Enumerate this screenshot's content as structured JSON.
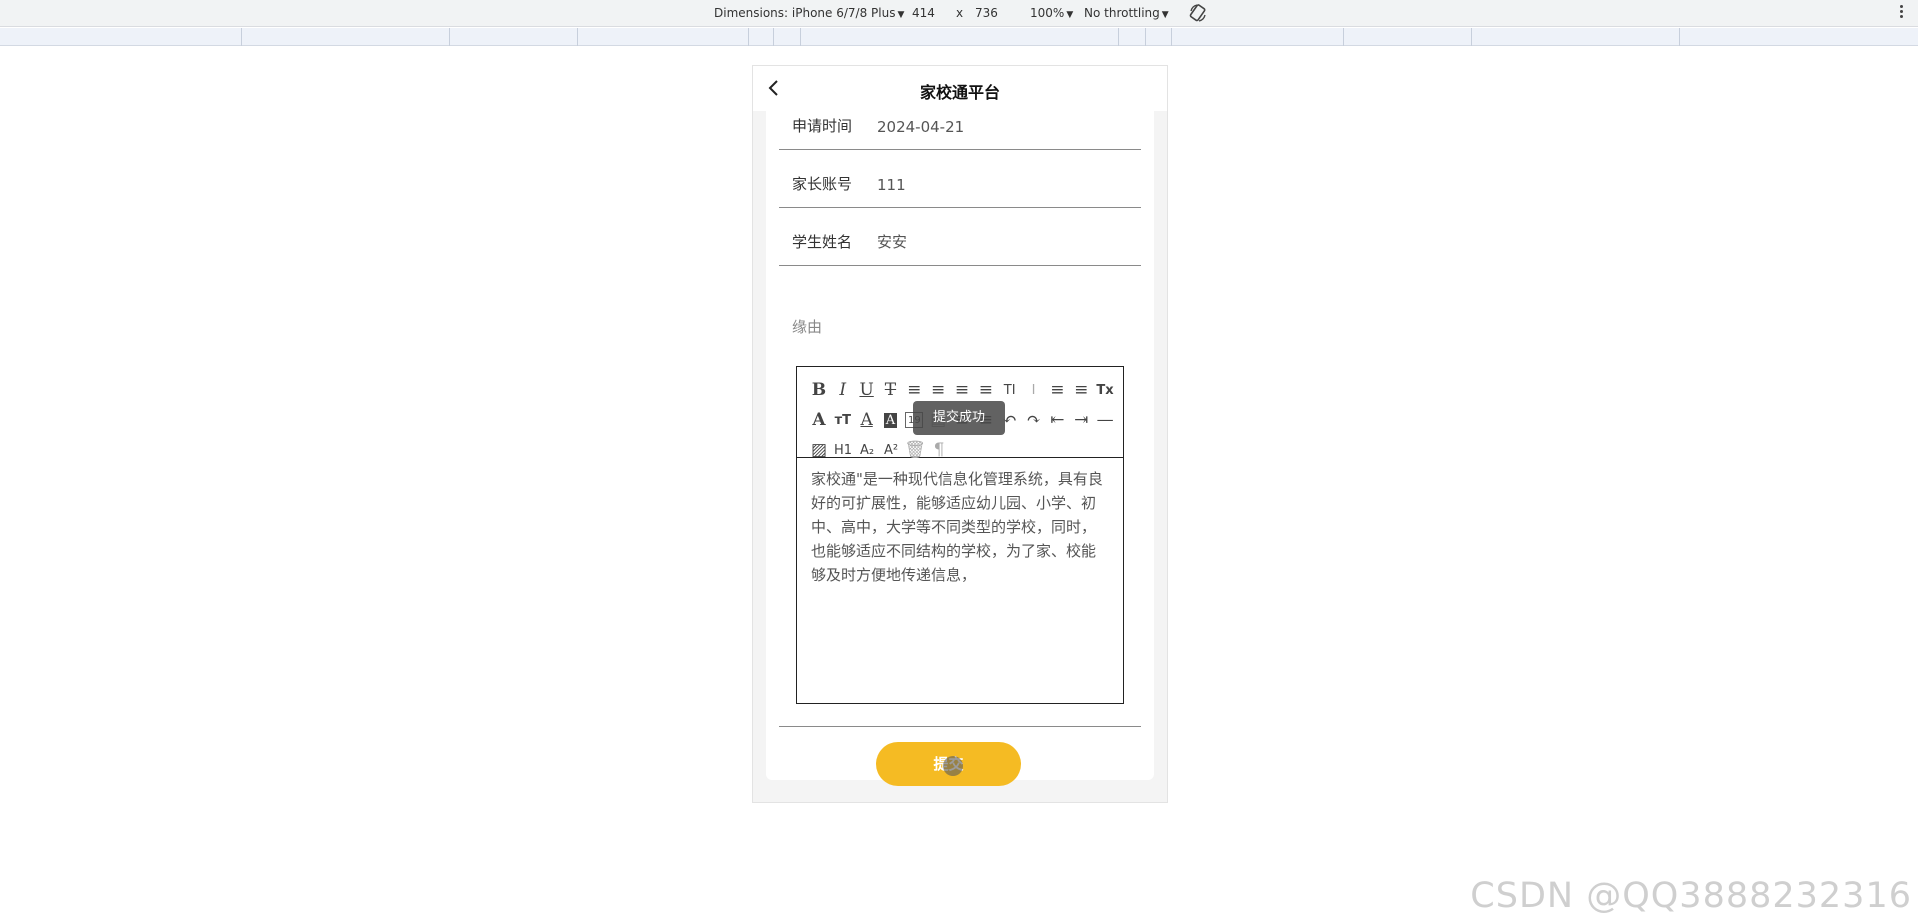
{
  "devtools": {
    "dimensions_label": "Dimensions: iPhone 6/7/8 Plus",
    "width": "414",
    "times": "x",
    "height": "736",
    "zoom": "100%",
    "throttling": "No throttling"
  },
  "header": {
    "title": "家校通平台"
  },
  "form": {
    "fields": [
      {
        "label": "申请时间",
        "value": "2024-04-21"
      },
      {
        "label": "家长账号",
        "value": "111"
      },
      {
        "label": "学生姓名",
        "value": "安安"
      }
    ],
    "reason_label": "缘由",
    "editor_content": "家校通\"是一种现代信息化管理系统，具有良好的可扩展性，能够适应幼儿园、小学、初中、高中，大学等不同类型的学校，同时，也能够适应不同结构的学校，为了家、校能够及时方便地传递信息，",
    "toolbar_row1": [
      "B",
      "I",
      "U",
      "T",
      "≡",
      "≡",
      "≡",
      "≡",
      "TI",
      "I",
      "≡",
      "≡",
      "Tx"
    ],
    "toolbar_row2": [
      "A",
      "T",
      "A",
      "A",
      "19",
      "▤",
      "≡",
      "≡",
      "↶",
      "↷",
      "⇤",
      "⇥",
      "—"
    ],
    "toolbar_row3": [
      "▨",
      "H1",
      "A₂",
      "A²",
      "🗑",
      "¶"
    ],
    "submit_label": "提交"
  },
  "toast": {
    "message": "提交成功"
  },
  "watermark": "CSDN @QQ3888232316",
  "colors": {
    "accent": "#f5bb23",
    "toast_bg": "#464646"
  }
}
